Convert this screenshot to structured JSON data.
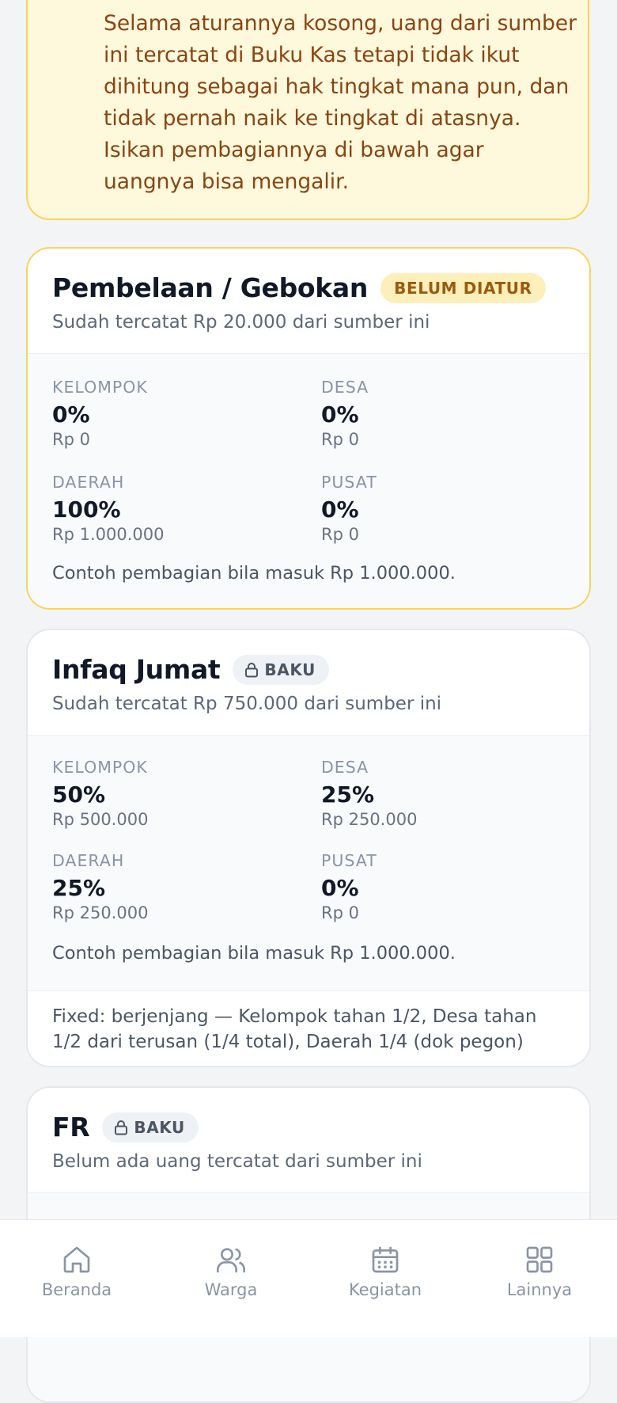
{
  "notice": {
    "text": "Selama aturannya kosong, uang dari sumber ini tercatat di Buku Kas tetapi tidak ikut dihitung sebagai hak tingkat mana pun, dan tidak pernah naik ke tingkat di atasnya. Isikan pembagiannya di bawah agar uangnya bisa mengalir."
  },
  "cards": [
    {
      "title": "Pembelaan / Gebokan",
      "badge": "BELUM DIATUR",
      "subtitle": "Sudah tercatat Rp 20.000 dari sumber ini",
      "cells": [
        {
          "label": "KELOMPOK",
          "pct": "0%",
          "amount": "Rp 0"
        },
        {
          "label": "DESA",
          "pct": "0%",
          "amount": "Rp 0"
        },
        {
          "label": "DAERAH",
          "pct": "100%",
          "amount": "Rp 1.000.000"
        },
        {
          "label": "PUSAT",
          "pct": "0%",
          "amount": "Rp 0"
        }
      ],
      "example": "Contoh pembagian bila masuk Rp 1.000.000."
    },
    {
      "title": "Infaq Jumat",
      "badge": "BAKU",
      "subtitle": "Sudah tercatat Rp 750.000 dari sumber ini",
      "cells": [
        {
          "label": "KELOMPOK",
          "pct": "50%",
          "amount": "Rp 500.000"
        },
        {
          "label": "DESA",
          "pct": "25%",
          "amount": "Rp 250.000"
        },
        {
          "label": "DAERAH",
          "pct": "25%",
          "amount": "Rp 250.000"
        },
        {
          "label": "PUSAT",
          "pct": "0%",
          "amount": "Rp 0"
        }
      ],
      "example": "Contoh pembagian bila masuk Rp 1.000.000.",
      "note": "Fixed: berjenjang — Kelompok tahan 1/2, Desa tahan 1/2 dari terusan (1/4 total), Daerah 1/4 (dok pegon)"
    },
    {
      "title": "FR",
      "badge": "BAKU",
      "subtitle": "Belum ada uang tercatat dari sumber ini"
    }
  ],
  "nav": [
    {
      "label": "Beranda",
      "icon": "home-icon"
    },
    {
      "label": "Warga",
      "icon": "users-icon"
    },
    {
      "label": "Kegiatan",
      "icon": "calendar-icon"
    },
    {
      "label": "Lainnya",
      "icon": "grid-icon"
    }
  ],
  "colors": {
    "notice_bg": "#fef8dd",
    "notice_border": "#f7d55b",
    "notice_text": "#8a4510",
    "badge_unset_bg": "#fdefb9",
    "badge_unset_text": "#9a5a10"
  }
}
